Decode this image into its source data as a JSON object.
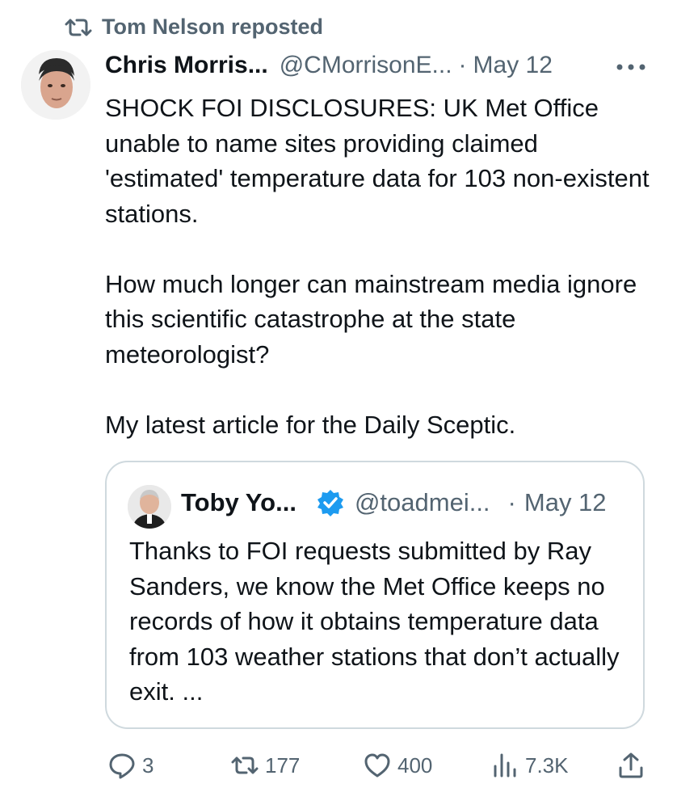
{
  "repost": {
    "label": "Tom Nelson reposted",
    "icon": "repost-icon"
  },
  "tweet": {
    "display_name": "Chris Morris...",
    "handle": "@CMorrisonE...",
    "separator": "·",
    "date": "May 12",
    "text": "SHOCK FOI DISCLOSURES: UK Met Office unable to name sites providing claimed 'estimated' temperature data for 103 non-existent stations.\n\nHow much longer can mainstream media ignore this scientific catastrophe at the state meteorologist?\n\nMy latest article for the Daily Sceptic."
  },
  "quoted_tweet": {
    "display_name": "Toby Yo...",
    "handle": "@toadmei...",
    "separator": "·",
    "date": "May 12",
    "verified": true,
    "text": "Thanks to FOI requests submitted by Ray Sanders, we know the Met Office keeps no records of how it obtains temperature data from 103 weather stations that don’t actually exit. ..."
  },
  "actions": {
    "replies": "3",
    "reposts": "177",
    "likes": "400",
    "views": "7.3K"
  },
  "colors": {
    "text": "#0f1419",
    "muted": "#536471",
    "verified": "#1d9bf0",
    "border": "#cfd9de"
  }
}
